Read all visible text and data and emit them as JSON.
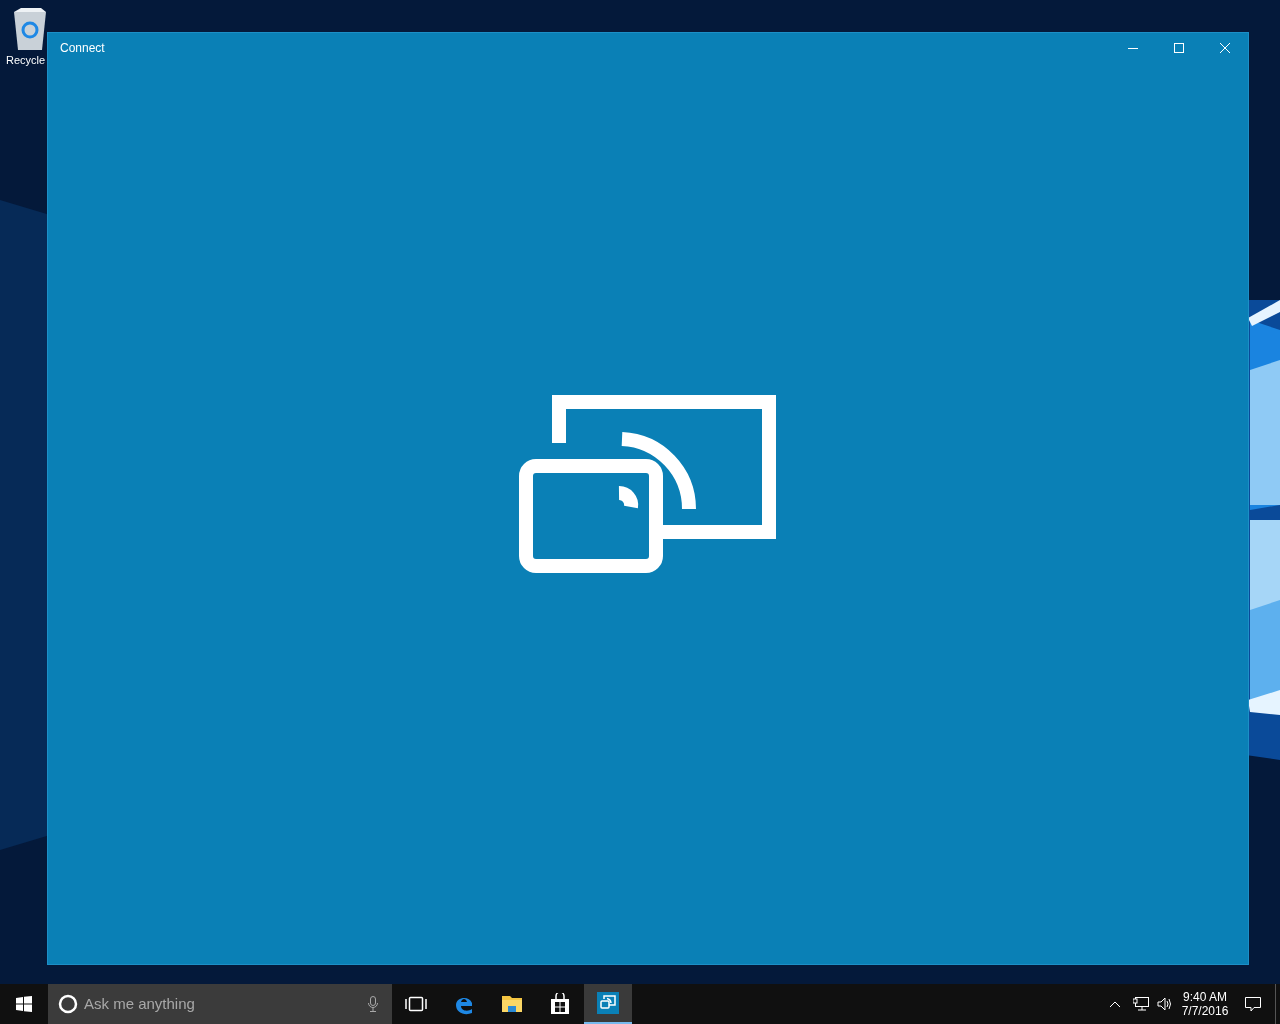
{
  "desktop_icons": [
    {
      "label": "Recycle"
    }
  ],
  "window": {
    "title": "Connect"
  },
  "taskbar": {
    "search": {
      "placeholder": "Ask me anything"
    },
    "apps": [
      {
        "kind": "taskview",
        "selected": false
      },
      {
        "kind": "edge",
        "selected": false
      },
      {
        "kind": "explorer",
        "selected": false
      },
      {
        "kind": "store",
        "selected": false
      },
      {
        "kind": "connect",
        "selected": true
      }
    ],
    "clock": {
      "time": "9:40 AM",
      "date": "7/7/2016"
    }
  }
}
